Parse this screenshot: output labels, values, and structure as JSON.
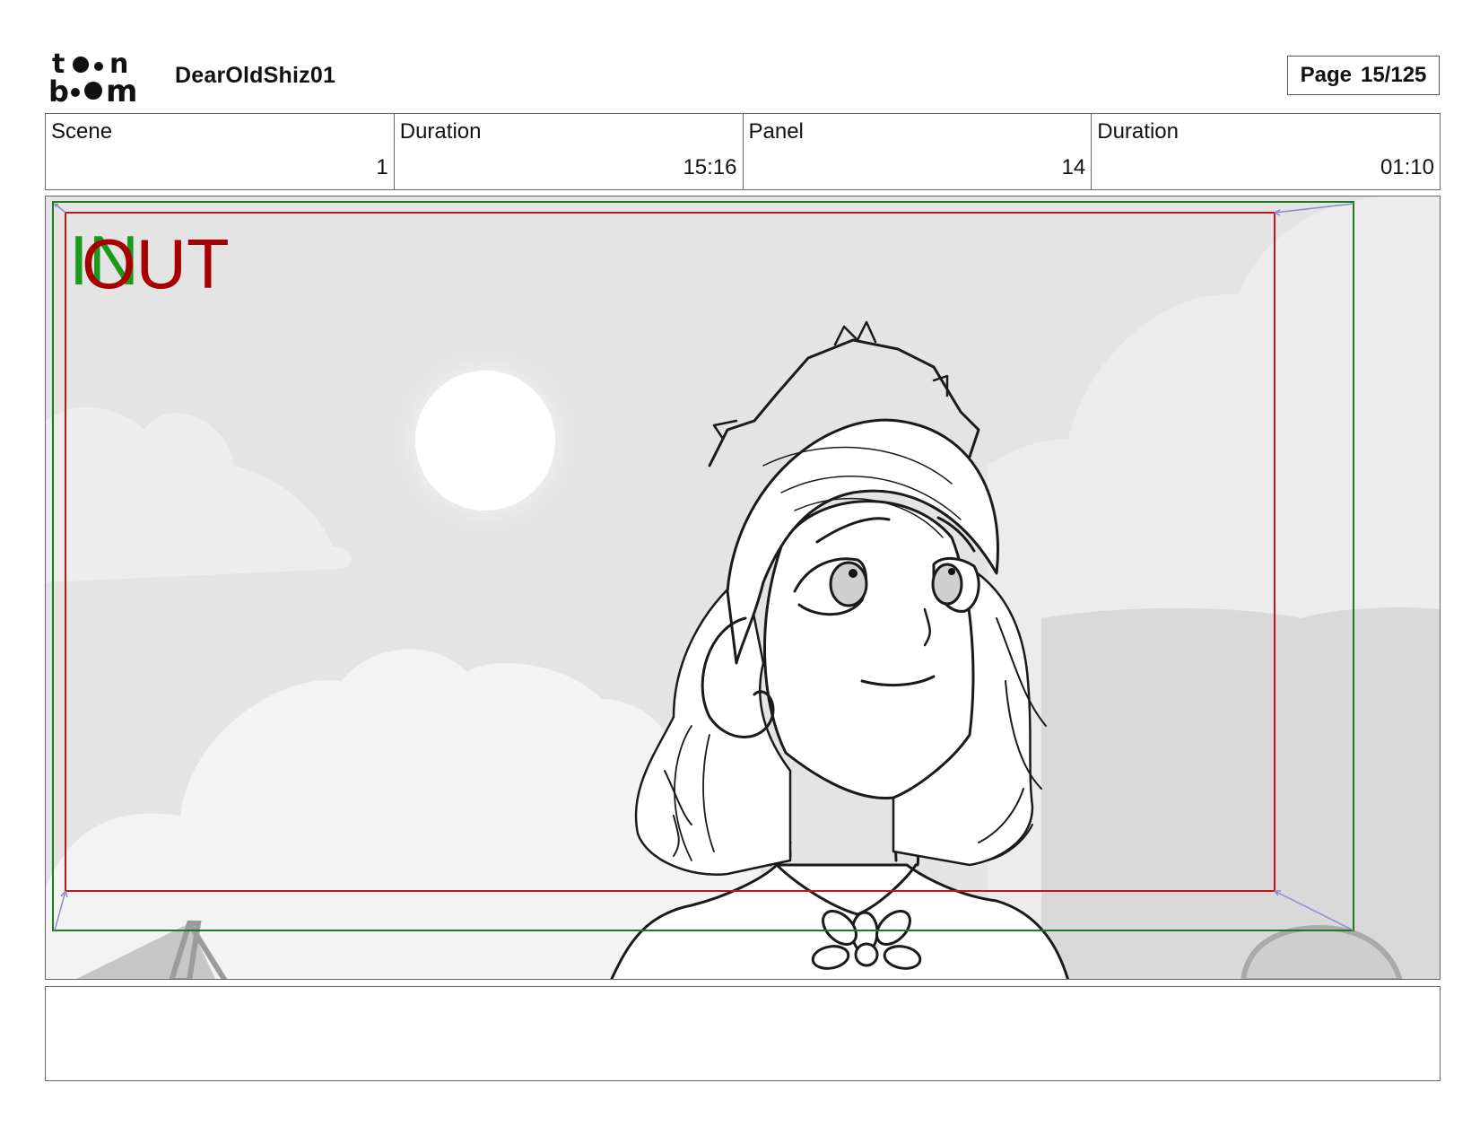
{
  "header": {
    "logo_text": "toon boom",
    "project_title": "DearOldShiz01",
    "page_label": "Page",
    "page_value": "15/125"
  },
  "info": {
    "scene_label": "Scene",
    "scene_value": "1",
    "scene_duration_label": "Duration",
    "scene_duration_value": "15:16",
    "panel_label": "Panel",
    "panel_value": "14",
    "panel_duration_label": "Duration",
    "panel_duration_value": "01:10"
  },
  "panel": {
    "in_marker": "IN",
    "out_marker": "OUT",
    "colors": {
      "in": "#1a9a1a",
      "out": "#a80000",
      "safe_frame": "#1c7a1c",
      "camera_frame": "#c0131a"
    }
  },
  "caption": {
    "text": ""
  }
}
